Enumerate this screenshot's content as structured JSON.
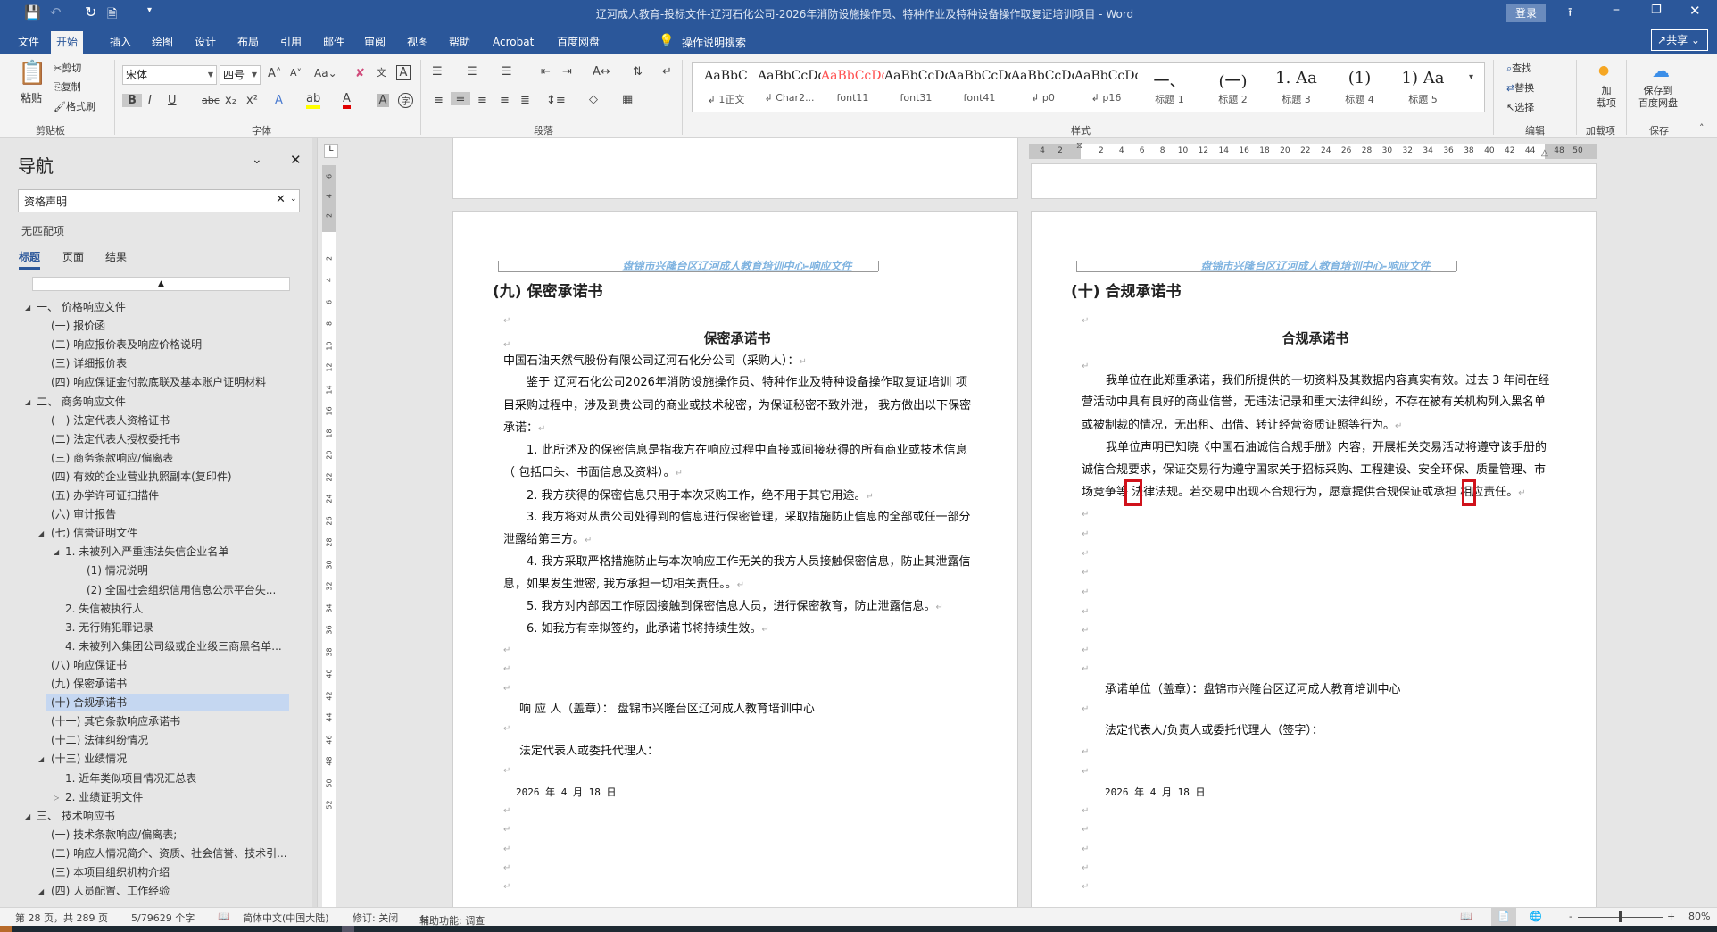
{
  "titlebar": {
    "title": "辽河成人教育-投标文件-辽河石化公司-2026年消防设施操作员、特种作业及特种设备操作取复证培训项目  -  Word",
    "login": "登录",
    "share": "共享",
    "quick_access": [
      "save-icon",
      "undo-icon",
      "redo-icon",
      "new-doc-icon",
      "customize-icon"
    ]
  },
  "tabs": [
    "文件",
    "开始",
    "插入",
    "绘图",
    "设计",
    "布局",
    "引用",
    "邮件",
    "审阅",
    "视图",
    "帮助",
    "Acrobat",
    "百度网盘"
  ],
  "tell_me": "操作说明搜索",
  "ribbon": {
    "clipboard": {
      "paste": "粘贴",
      "cut": "剪切",
      "copy": "复制",
      "format_painter": "格式刷",
      "label": "剪贴板"
    },
    "font": {
      "name": "宋体",
      "size": "四号",
      "label": "字体",
      "highlight_color": "#ffff00",
      "font_color": "#e00000"
    },
    "paragraph": {
      "label": "段落"
    },
    "styles": {
      "label": "样式",
      "items": [
        {
          "preview": "AaBbC",
          "label": "↲ 1正文"
        },
        {
          "preview": "AaBbCcDdI",
          "label": "↲ Char2..."
        },
        {
          "preview": "AaBbCcDdI",
          "label": "font11"
        },
        {
          "preview": "AaBbCcDc",
          "label": "font31"
        },
        {
          "preview": "AaBbCcDdI",
          "label": "font41"
        },
        {
          "preview": "AaBbCcDc",
          "label": "↲ p0"
        },
        {
          "preview": "AaBbCcDc",
          "label": "↲ p16"
        },
        {
          "preview": "一、",
          "label": "标题 1"
        },
        {
          "preview": "(一)",
          "label": "标题 2"
        },
        {
          "preview": "1.  Aa",
          "label": "标题 3"
        },
        {
          "preview": "(1)",
          "label": "标题 4"
        },
        {
          "preview": "1)  Aa",
          "label": "标题 5"
        }
      ]
    },
    "editing": {
      "find": "查找",
      "replace": "替换",
      "select": "选择",
      "label": "编辑"
    },
    "addins": {
      "button": "加\n载项",
      "label": "加载项"
    },
    "save": {
      "button": "保存到\n百度网盘",
      "label": "保存"
    }
  },
  "nav": {
    "title": "导航",
    "search_value": "资格声明",
    "no_match": "无匹配项",
    "tabs": [
      "标题",
      "页面",
      "结果"
    ],
    "items": [
      {
        "text": "一、  价格响应文件",
        "level": 1,
        "arrow": "expanded"
      },
      {
        "text": "(一) 报价函",
        "level": 2
      },
      {
        "text": "(二) 响应报价表及响应价格说明",
        "level": 2
      },
      {
        "text": "(三) 详细报价表",
        "level": 2
      },
      {
        "text": "(四) 响应保证金付款底联及基本账户证明材料",
        "level": 2
      },
      {
        "text": "二、  商务响应文件",
        "level": 1,
        "arrow": "expanded"
      },
      {
        "text": "(一) 法定代表人资格证书",
        "level": 2
      },
      {
        "text": "(二) 法定代表人授权委托书",
        "level": 2
      },
      {
        "text": "(三) 商务条款响应/偏离表",
        "level": 2
      },
      {
        "text": "(四) 有效的企业营业执照副本(复印件)",
        "level": 2
      },
      {
        "text": "(五) 办学许可证扫描件",
        "level": 2
      },
      {
        "text": "(六) 审计报告",
        "level": 2
      },
      {
        "text": "(七) 信誉证明文件",
        "level": 2,
        "arrow": "expanded"
      },
      {
        "text": "1. 未被列入严重违法失信企业名单",
        "level": 3,
        "arrow": "expanded"
      },
      {
        "text": "(1)   情况说明",
        "level": 4
      },
      {
        "text": "(2)   全国社会组织信用信息公示平台失...",
        "level": 4
      },
      {
        "text": "2. 失信被执行人",
        "level": 3
      },
      {
        "text": "3. 无行贿犯罪记录",
        "level": 3
      },
      {
        "text": "4. 未被列入集团公司级或企业级三商黑名单...",
        "level": 3
      },
      {
        "text": "(八) 响应保证书",
        "level": 2
      },
      {
        "text": "(九) 保密承诺书",
        "level": 2
      },
      {
        "text": "(十) 合规承诺书",
        "level": 2,
        "selected": true
      },
      {
        "text": "(十一) 其它条款响应承诺书",
        "level": 2
      },
      {
        "text": "(十二) 法律纠纷情况",
        "level": 2
      },
      {
        "text": "(十三) 业绩情况",
        "level": 2,
        "arrow": "expanded"
      },
      {
        "text": "1. 近年类似项目情况汇总表",
        "level": 3
      },
      {
        "text": "2. 业绩证明文件",
        "level": 3,
        "arrow": "collapsed"
      },
      {
        "text": "三、  技术响应书",
        "level": 1,
        "arrow": "expanded"
      },
      {
        "text": "(一) 技术条款响应/偏离表;",
        "level": 2
      },
      {
        "text": "(二) 响应人情况简介、资质、社会信誉、技术引...",
        "level": 2
      },
      {
        "text": "(三) 本项目组织机构介绍",
        "level": 2
      },
      {
        "text": "(四) 人员配置、工作经验",
        "level": 2,
        "arrow": "expanded"
      }
    ]
  },
  "ruler": {
    "labels": [
      "4",
      "2",
      "2",
      "4",
      "6",
      "8",
      "10",
      "12",
      "14",
      "16",
      "18",
      "20",
      "22",
      "24",
      "26",
      "28",
      "30",
      "32",
      "34",
      "36",
      "38",
      "40",
      "42",
      "44",
      "48",
      "50"
    ]
  },
  "vruler": {
    "labels": [
      "6",
      "4",
      "2",
      "2",
      "4",
      "6",
      "8",
      "10",
      "12",
      "14",
      "16",
      "18",
      "20",
      "22",
      "24",
      "26",
      "28",
      "30",
      "32",
      "34",
      "36",
      "38",
      "40",
      "42",
      "44",
      "46",
      "48",
      "50",
      "52"
    ]
  },
  "pages": [
    {
      "header": "盘锦市兴隆台区辽河成人教育培训中心-响应文件",
      "heading": "(九)  保密承诺书",
      "title": "保密承诺书",
      "lines": [
        {
          "text": "中国石油天然气股份有限公司辽河石化分公司（采购人）：",
          "indent": false,
          "full": false,
          "pm": true
        },
        {
          "text": "鉴于  辽河石化公司2026年消防设施操作员、特种作业及特种设备操作取复证培训  项",
          "indent": true,
          "full": true,
          "pm": false
        },
        {
          "text": "目采购过程中，涉及到贵公司的商业或技术秘密，为保证秘密不致外泄， 我方做出以下保密",
          "indent": false,
          "full": true,
          "pm": false
        },
        {
          "text": "承诺：",
          "indent": false,
          "full": false,
          "pm": true
        },
        {
          "text": "1.  此所述及的保密信息是指我方在响应过程中直接或间接获得的所有商业或技术信息",
          "indent": true,
          "full": true,
          "pm": false
        },
        {
          "text": "（ 包括口头、书面信息及资料）。",
          "indent": false,
          "full": false,
          "pm": true
        },
        {
          "text": "2.  我方获得的保密信息只用于本次采购工作，绝不用于其它用途。",
          "indent": true,
          "full": false,
          "pm": true
        },
        {
          "text": "3.  我方将对从贵公司处得到的信息进行保密管理，采取措施防止信息的全部或任一部分",
          "indent": true,
          "full": true,
          "pm": false
        },
        {
          "text": "泄露给第三方。",
          "indent": false,
          "full": false,
          "pm": true
        },
        {
          "text": "4.  我方采取严格措施防止与本次响应工作无关的我方人员接触保密信息，防止其泄露信",
          "indent": true,
          "full": true,
          "pm": false
        },
        {
          "text": "息，如果发生泄密, 我方承担一切相关责任。。",
          "indent": false,
          "full": false,
          "pm": true
        },
        {
          "text": "5.  我方对内部因工作原因接触到保密信息人员，进行保密教育，防止泄露信息。",
          "indent": true,
          "full": false,
          "pm": true
        },
        {
          "text": "6.  如我方有幸拟签约，此承诺书将持续生效。",
          "indent": true,
          "full": false,
          "pm": true
        }
      ],
      "signature": [
        {
          "text": "响 应 人（盖章）：  盘锦市兴隆台区辽河成人教育培训中心"
        },
        {
          "text": "法定代表人或委托代理人："
        },
        {
          "text": "2026 年 4 月 18 日"
        }
      ]
    },
    {
      "header": "盘锦市兴隆台区辽河成人教育培训中心-响应文件",
      "heading": "(十)  合规承诺书",
      "title": "合规承诺书",
      "lines": [
        {
          "text": "我单位在此郑重承诺，我们所提供的一切资料及其数据内容真实有效。过去 3 年间在经",
          "indent": true,
          "full": true,
          "pm": false
        },
        {
          "text": "营活动中具有良好的商业信誉，无违法记录和重大法律纠纷，不存在被有关机构列入黑名单",
          "indent": false,
          "full": true,
          "pm": false
        },
        {
          "text": "或被制裁的情况，无出租、出借、转让经营资质证照等行为。",
          "indent": false,
          "full": false,
          "pm": true
        },
        {
          "text": "我单位声明已知晓《中国石油诚信合规手册》内容，开展相关交易活动将遵守该手册的",
          "indent": true,
          "full": true,
          "pm": false
        },
        {
          "text": "诚信合规要求，保证交易行为遵守国家关于招标采购、工程建设、安全环保、质量管理、市",
          "indent": false,
          "full": true,
          "pm": false
        },
        {
          "text": "场竞争等  法律法规。若交易中出现不合规行为，愿意提供合规保证或承担  相应责任。",
          "indent": false,
          "full": false,
          "pm": true
        }
      ],
      "signature": [
        {
          "text": "承诺单位（盖章）：盘锦市兴隆台区辽河成人教育培训中心"
        },
        {
          "text": "法定代表人/负责人或委托代理人（签字）："
        },
        {
          "text": "2026 年 4 月 18 日"
        }
      ],
      "highlight_color": "#d0121b"
    }
  ],
  "status": {
    "page": "第 28 页，共 289 页",
    "words": "5/79629 个字",
    "language": "简体中文(中国大陆)",
    "track_changes": "修订: 关闭",
    "accessibility": "辅助功能: 调查",
    "zoom": "80%",
    "zoom_percent": 80
  }
}
